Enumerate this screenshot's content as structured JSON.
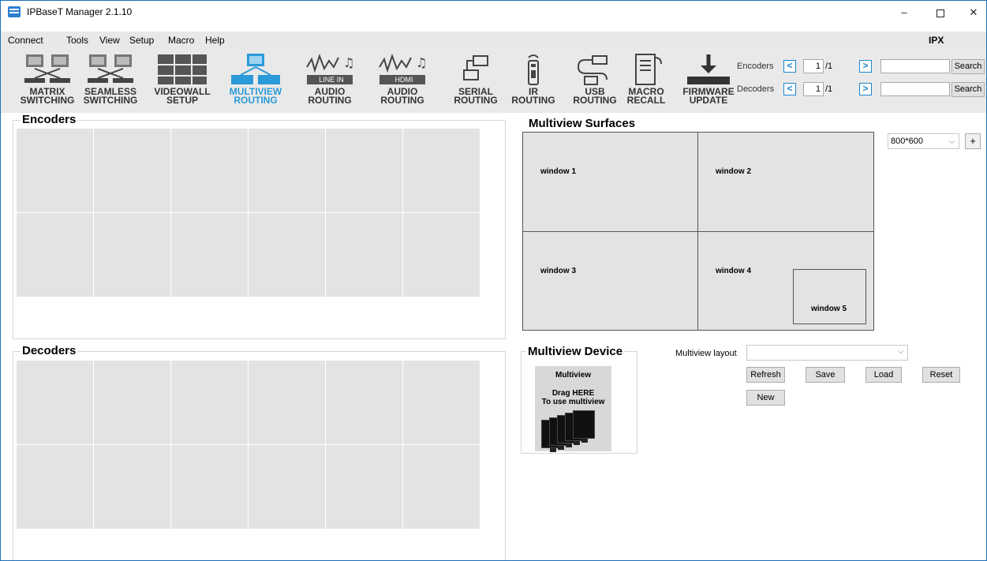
{
  "window": {
    "title": "IPBaseT Manager 2.1.10",
    "min": "–",
    "close": "✕"
  },
  "menu": {
    "items": [
      "Connect",
      "Tools",
      "View",
      "Setup",
      "Macro",
      "Help"
    ],
    "right_label": "IPX"
  },
  "toolbar": {
    "tools": [
      {
        "label": "MATRIX\nSWITCHING",
        "icon": "matrix-switching-icon"
      },
      {
        "label": "SEAMLESS\nSWITCHING",
        "icon": "seamless-switching-icon"
      },
      {
        "label": "VIDEOWALL\nSETUP",
        "icon": "videowall-icon"
      },
      {
        "label": "MULTIVIEW\nROUTING",
        "icon": "multiview-icon",
        "active": true
      },
      {
        "label": "AUDIO\nROUTING",
        "icon": "audio-line-in-icon",
        "badge": "LINE IN"
      },
      {
        "label": "AUDIO\nROUTING",
        "icon": "audio-hdmi-icon",
        "badge": "HDMI"
      },
      {
        "label": "SERIAL\nROUTING",
        "icon": "serial-icon"
      },
      {
        "label": "IR\nROUTING",
        "icon": "ir-remote-icon"
      },
      {
        "label": "USB\nROUTING",
        "icon": "usb-icon"
      },
      {
        "label": "MACRO\nRECALL",
        "icon": "macro-icon"
      },
      {
        "label": "FIRMWARE\nUPDATE",
        "icon": "firmware-download-icon"
      }
    ],
    "encoders_pager": {
      "label": "Encoders",
      "page": "1",
      "total": "/1",
      "search_label": "Search",
      "prev": "<",
      "next": ">"
    },
    "decoders_pager": {
      "label": "Decoders",
      "page": "1",
      "total": "/1",
      "search_label": "Search",
      "prev": "<",
      "next": ">"
    }
  },
  "encoders": {
    "title": "Encoders"
  },
  "decoders": {
    "title": "Decoders"
  },
  "multiview_surfaces": {
    "title": "Multiview Surfaces",
    "windows": [
      "window 1",
      "window 2",
      "window 3",
      "window 4",
      "window 5"
    ],
    "resolution": "800*600",
    "add_label": "+"
  },
  "multiview_device": {
    "title": "Multiview Device",
    "drop_title": "Multiview",
    "drop_hint_1": "Drag HERE",
    "drop_hint_2": "To use multiview"
  },
  "layout": {
    "label": "Multiview layout",
    "selected": "",
    "buttons": {
      "refresh": "Refresh",
      "save": "Save",
      "load": "Load",
      "reset": "Reset",
      "new": "New"
    }
  },
  "colors": {
    "accent": "#2a9ad8",
    "toolbar_bg": "#e9e9e9",
    "cell_bg": "#e3e3e3"
  }
}
